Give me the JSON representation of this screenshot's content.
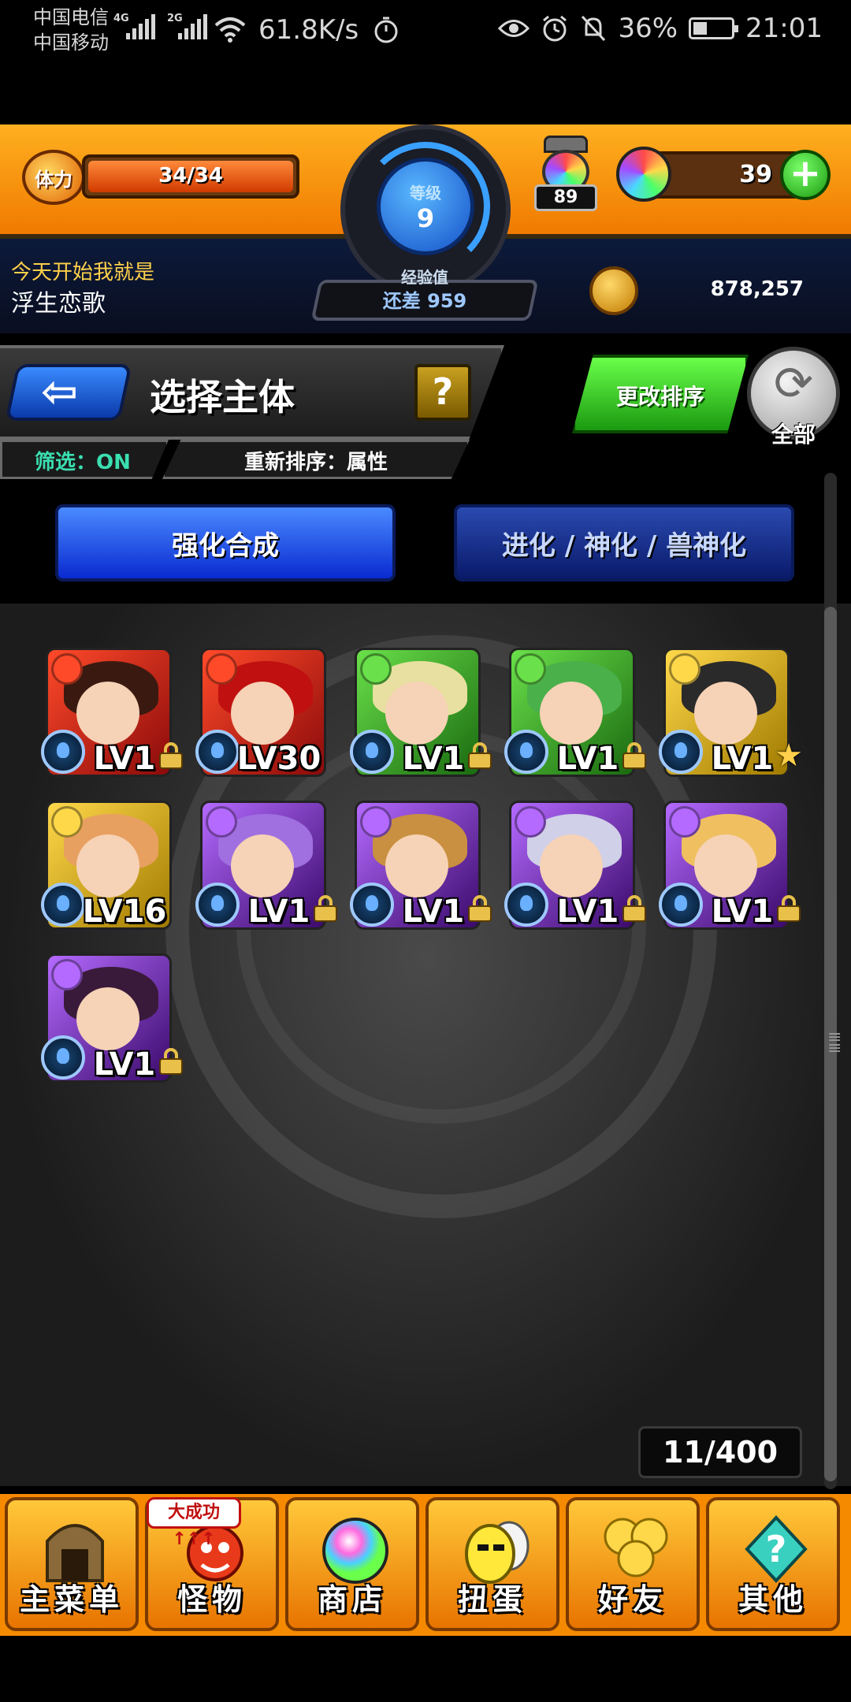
{
  "status_bar": {
    "carrier_1": "中国电信",
    "carrier_2": "中国移动",
    "sig1_tag": "4G",
    "sig2_tag": "2G",
    "net_speed": "61.8K/s",
    "battery": "36%",
    "time": "21:01",
    "icons": [
      "wifi-icon",
      "timer-icon",
      "eye-icon",
      "alarm-icon",
      "mute-icon",
      "battery-icon"
    ]
  },
  "header": {
    "stamina_label": "体力",
    "stamina_text": "34/34",
    "stamina_fraction": 1.0,
    "level_label": "等级",
    "level_value": "9",
    "level_progress": 0.3,
    "material_count": "89",
    "orb_count": "39",
    "plus_symbol": "+",
    "exp_label": "经验值",
    "exp_remaining": "还差 959",
    "motto": "今天开始我就是",
    "username": "浮生恋歌",
    "coins": "878,257"
  },
  "title_panel": {
    "title": "选择主体",
    "help_label": "?",
    "filter": "筛选：ON",
    "sort": "重新排序：属性",
    "change_sort_label": "更改排序",
    "all_label": "全部"
  },
  "tabs": {
    "power_up": "强化合成",
    "evolve": "进化 / 神化 / 兽神化"
  },
  "monsters": [
    {
      "level": "LV1",
      "element": "fire",
      "locked": true
    },
    {
      "level": "LV30",
      "element": "fire",
      "locked": false
    },
    {
      "level": "LV1",
      "element": "wood",
      "locked": true
    },
    {
      "level": "LV1",
      "element": "wood",
      "locked": true
    },
    {
      "level": "LV1",
      "element": "light",
      "locked": false,
      "star": true
    },
    {
      "level": "LV16",
      "element": "light",
      "locked": false
    },
    {
      "level": "LV1",
      "element": "dark",
      "locked": true
    },
    {
      "level": "LV1",
      "element": "dark",
      "locked": true
    },
    {
      "level": "LV1",
      "element": "dark",
      "locked": true
    },
    {
      "level": "LV1",
      "element": "dark",
      "locked": true
    },
    {
      "level": "LV1",
      "element": "dark",
      "locked": true
    }
  ],
  "box_count": "11/400",
  "bottom_nav": {
    "badge": "大成功↑↑↑",
    "items": [
      {
        "label": "主菜单",
        "icon": "gate-icon"
      },
      {
        "label": "怪物",
        "icon": "dragon-icon"
      },
      {
        "label": "商店",
        "icon": "orb-icon"
      },
      {
        "label": "扭蛋",
        "icon": "egg-icon"
      },
      {
        "label": "好友",
        "icon": "balloons-icon"
      },
      {
        "label": "其他",
        "icon": "question-icon"
      }
    ]
  },
  "colors": {
    "header_orange": "#f58a00",
    "tab_blue": "#0a2ad0",
    "green_button": "#1a9a10",
    "filter_teal": "#3adfb0"
  }
}
